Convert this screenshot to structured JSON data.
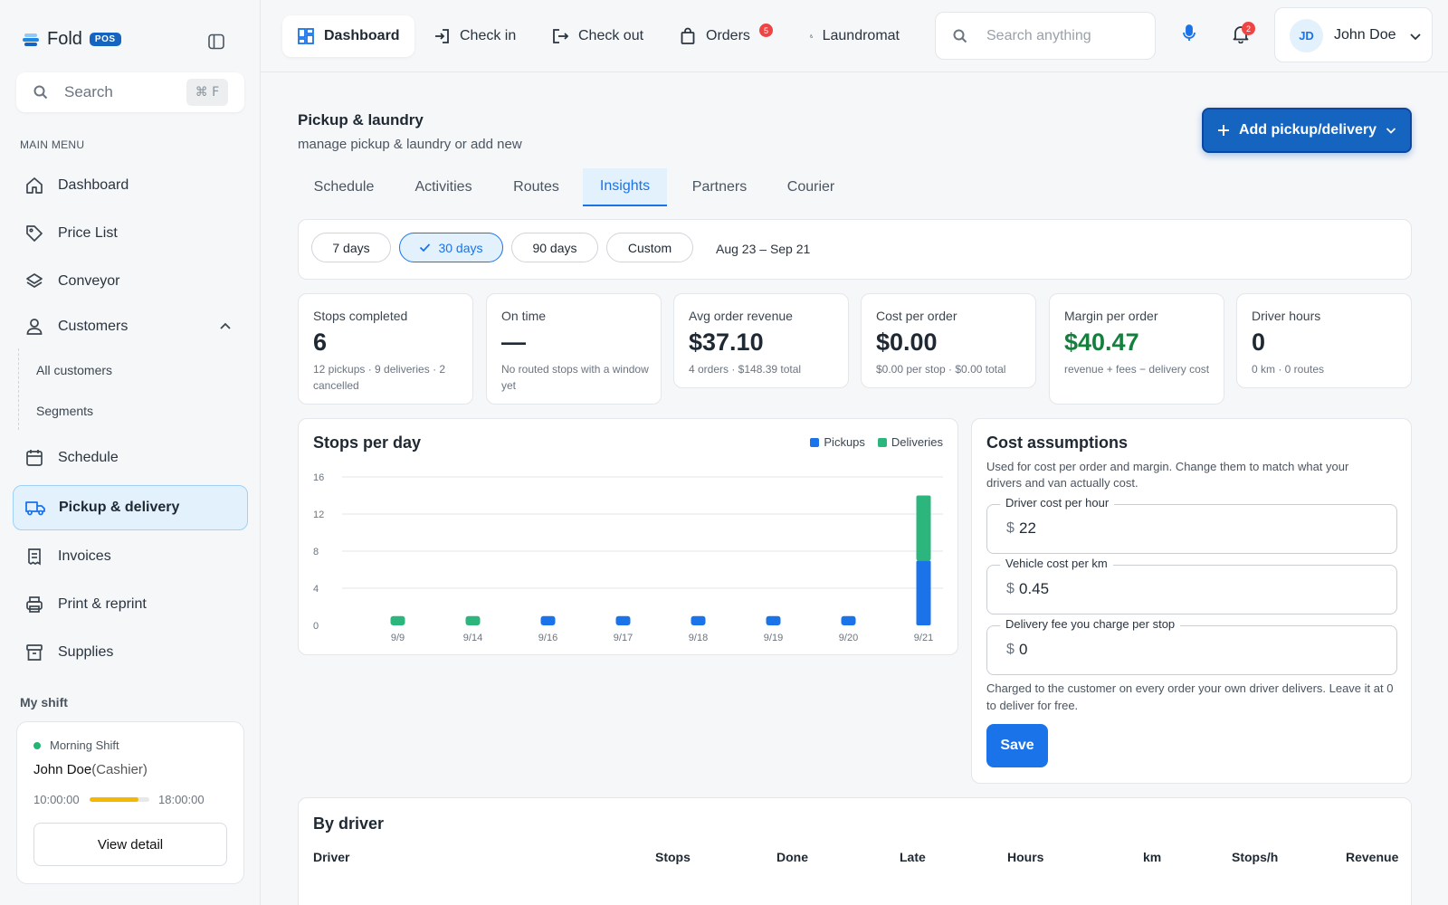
{
  "brand": {
    "name": "Fold",
    "badge": "POS"
  },
  "sidebar": {
    "search_placeholder": "Search",
    "search_shortcut": "⌘ F",
    "menu_title": "MAIN MENU",
    "items": [
      {
        "label": "Dashboard",
        "icon": "home-icon"
      },
      {
        "label": "Price List",
        "icon": "tag-icon"
      },
      {
        "label": "Conveyor",
        "icon": "layers-icon"
      },
      {
        "label": "Customers",
        "icon": "user-icon"
      },
      {
        "label": "Schedule",
        "icon": "calendar-icon"
      },
      {
        "label": "Pickup & delivery",
        "icon": "truck-icon"
      },
      {
        "label": "Invoices",
        "icon": "receipt-icon"
      },
      {
        "label": "Print & reprint",
        "icon": "printer-icon"
      },
      {
        "label": "Supplies",
        "icon": "archive-icon"
      }
    ],
    "customers_sub": [
      "All customers",
      "Segments"
    ],
    "shift": {
      "title": "My shift",
      "name": "Morning Shift",
      "user": "John Doe",
      "role": "(Cashier)",
      "start": "10:00:00",
      "end": "18:00:00",
      "progress": 0.82,
      "detail_label": "View detail"
    }
  },
  "topbar": {
    "tabs": [
      "Dashboard",
      "Check in",
      "Check out",
      "Orders",
      "Laundromat"
    ],
    "orders_badge": "5",
    "search_placeholder": "Search anything",
    "notifications_badge": "2",
    "user": {
      "initials": "JD",
      "name": "John Doe"
    }
  },
  "page": {
    "title": "Pickup & laundry",
    "subtitle": "manage pickup & laundry or add new",
    "add_button": "Add pickup/delivery",
    "tabs": [
      "Schedule",
      "Activities",
      "Routes",
      "Insights",
      "Partners",
      "Courier"
    ],
    "active_tab": "Insights"
  },
  "filters": {
    "ranges": [
      "7 days",
      "30 days",
      "90 days",
      "Custom"
    ],
    "selected": "30 days",
    "date_range": "Aug 23 – Sep 21"
  },
  "stats": [
    {
      "label": "Stops completed",
      "value": "6",
      "sub": "12 pickups · 9 deliveries · 2 cancelled"
    },
    {
      "label": "On time",
      "value": "—",
      "sub": "No routed stops with a window yet"
    },
    {
      "label": "Avg order revenue",
      "value": "$37.10",
      "sub": "4 orders · $148.39 total"
    },
    {
      "label": "Cost per order",
      "value": "$0.00",
      "sub": "$0.00 per stop · $0.00 total"
    },
    {
      "label": "Margin per order",
      "value": "$40.47",
      "sub": "revenue + fees − delivery cost"
    },
    {
      "label": "Driver hours",
      "value": "0",
      "sub": "0 km · 0 routes"
    }
  ],
  "colors": {
    "pickups": "#1a73e8",
    "deliveries": "#2cb67d",
    "accent": "#1565c0",
    "margin": "#15803d"
  },
  "chart_data": {
    "type": "bar",
    "title": "Stops per day",
    "stacked": true,
    "categories": [
      "9/9",
      "9/14",
      "9/16",
      "9/17",
      "9/18",
      "9/19",
      "9/20",
      "9/21"
    ],
    "series": [
      {
        "name": "Pickups",
        "values": [
          0,
          0,
          1,
          1,
          1,
          1,
          1,
          7
        ]
      },
      {
        "name": "Deliveries",
        "values": [
          1,
          1,
          0,
          0,
          0,
          0,
          0,
          7
        ]
      }
    ],
    "yticks": [
      0,
      4,
      8,
      12,
      16
    ],
    "ylim": [
      0,
      16
    ],
    "legend": "top-right",
    "grid": true
  },
  "cost_assumptions": {
    "title": "Cost assumptions",
    "description": "Used for cost per order and margin. Change them to match what your drivers and van actually cost.",
    "fields": [
      {
        "label": "Driver cost per hour",
        "prefix": "$",
        "value": "22"
      },
      {
        "label": "Vehicle cost per km",
        "prefix": "$",
        "value": "0.45"
      },
      {
        "label": "Delivery fee you charge per stop",
        "prefix": "$",
        "value": "0"
      }
    ],
    "note": "Charged to the customer on every order your own driver delivers. Leave it at 0 to deliver for free.",
    "save_label": "Save"
  },
  "by_driver": {
    "title": "By driver",
    "columns": [
      "Driver",
      "Stops",
      "Done",
      "Late",
      "Hours",
      "km",
      "Stops/h",
      "Revenue"
    ]
  }
}
